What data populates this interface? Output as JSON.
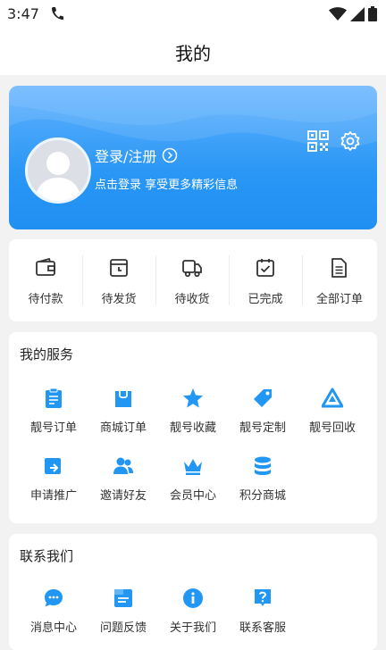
{
  "status": {
    "time": "3:47"
  },
  "header": {
    "title": "我的"
  },
  "profile": {
    "login_label": "登录/注册",
    "subtitle": "点击登录 享受更多精彩信息"
  },
  "orders": [
    {
      "label": "待付款",
      "icon": "wallet-icon"
    },
    {
      "label": "待发货",
      "icon": "package-icon"
    },
    {
      "label": "待收货",
      "icon": "truck-icon"
    },
    {
      "label": "已完成",
      "icon": "calendar-check-icon"
    },
    {
      "label": "全部订单",
      "icon": "document-icon"
    }
  ],
  "services": {
    "title": "我的服务",
    "items": [
      {
        "label": "靓号订单",
        "icon": "clipboard-icon"
      },
      {
        "label": "商城订单",
        "icon": "shopping-bag-icon"
      },
      {
        "label": "靓号收藏",
        "icon": "star-icon"
      },
      {
        "label": "靓号定制",
        "icon": "tag-icon"
      },
      {
        "label": "靓号回收",
        "icon": "recycle-icon"
      },
      {
        "label": "申请推广",
        "icon": "share-icon"
      },
      {
        "label": "邀请好友",
        "icon": "users-icon"
      },
      {
        "label": "会员中心",
        "icon": "crown-icon"
      },
      {
        "label": "积分商城",
        "icon": "database-icon"
      }
    ]
  },
  "contact": {
    "title": "联系我们",
    "items": [
      {
        "label": "消息中心",
        "icon": "chat-icon"
      },
      {
        "label": "问题反馈",
        "icon": "feedback-icon"
      },
      {
        "label": "关于我们",
        "icon": "info-icon"
      },
      {
        "label": "联系客服",
        "icon": "question-icon"
      }
    ]
  },
  "colors": {
    "accent": "#2196F3",
    "card_gradient_top": "#62b2ff",
    "card_gradient_bottom": "#1f8ff2"
  }
}
